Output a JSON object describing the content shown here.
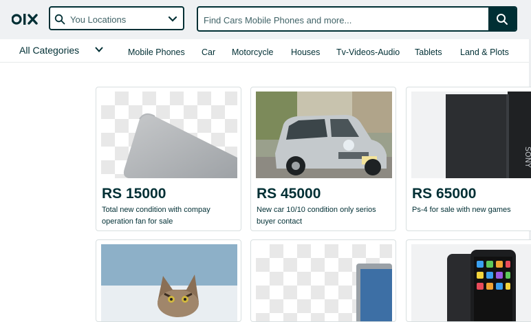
{
  "header": {
    "location_placeholder": "You Locations",
    "search_placeholder": "Find Cars Mobile Phones and more..."
  },
  "nav": {
    "all_categories": "All Categories",
    "categories": [
      "Mobile Phones",
      "Car",
      "Motorcycle",
      "Houses",
      "Tv-Videos-Audio",
      "Tablets",
      "Land & Plots"
    ]
  },
  "listings": [
    {
      "price": "RS 15000",
      "description": "Total new condition with compay operation fan for sale"
    },
    {
      "price": "RS 45000",
      "description": "New car 10/10 condition only serios buyer contact"
    },
    {
      "price": "RS 65000",
      "description": "Ps-4 for sale with new games"
    },
    {
      "price": "",
      "description": ""
    },
    {
      "price": "",
      "description": ""
    },
    {
      "price": "",
      "description": ""
    }
  ],
  "colors": {
    "brand": "#002f34",
    "background": "#eff1f3"
  }
}
